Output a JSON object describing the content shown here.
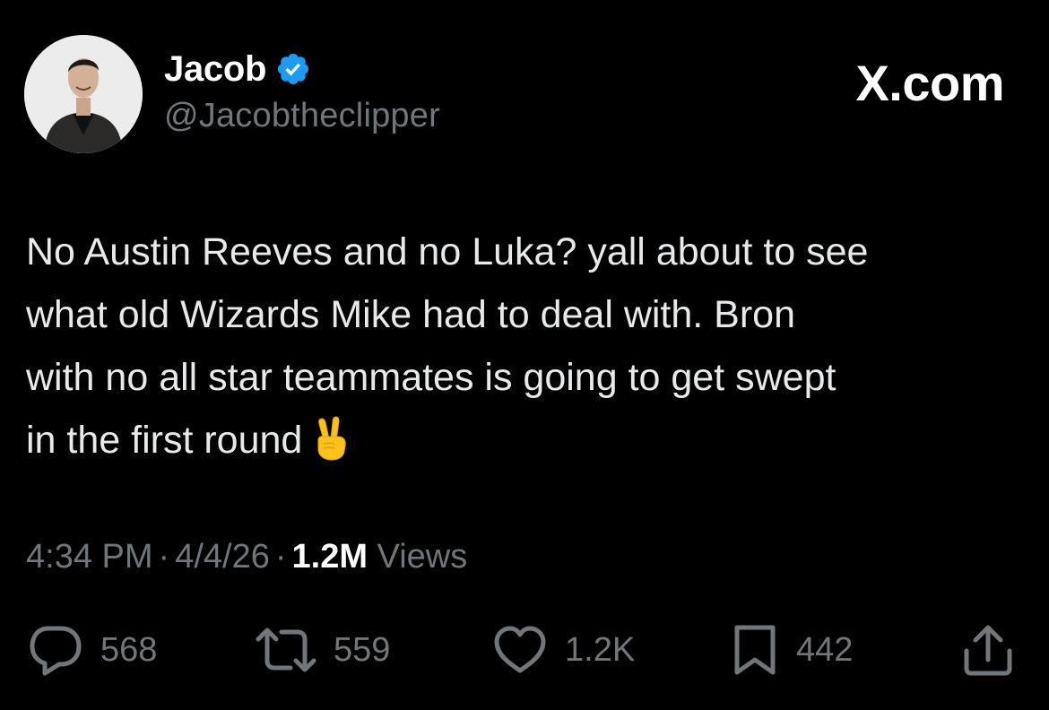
{
  "header": {
    "display_name": "Jacob",
    "handle": "@Jacobtheclipper",
    "brand": "X.com",
    "verified_color": "#1d9bf0"
  },
  "tweet": {
    "text": "No Austin Reeves and no Luka? yall about to see\nwhat old Wizards Mike had to deal with. Bron\nwith no all star teammates is going to get swept\nin the first round",
    "emoji": "victory-hand-emoji"
  },
  "meta": {
    "time": "4:34 PM",
    "date": "4/4/26",
    "views_count": "1.2M",
    "views_label": "Views",
    "separator": "·"
  },
  "actions": {
    "replies": "568",
    "reposts": "559",
    "likes": "1.2K",
    "bookmarks": "442"
  },
  "colors": {
    "background": "#000000",
    "text_primary": "#e7e9ea",
    "text_secondary": "#71767b"
  }
}
